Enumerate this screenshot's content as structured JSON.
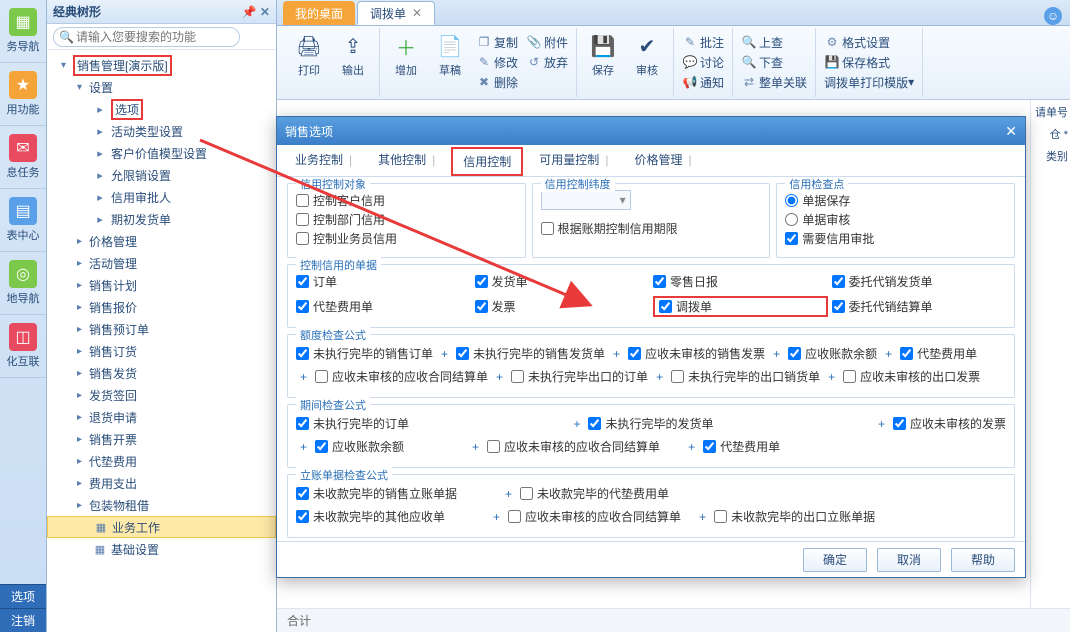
{
  "dock": {
    "items": [
      {
        "label": "务导航",
        "color": "#7cc84a"
      },
      {
        "label": "用功能",
        "color": "#f5a43a"
      },
      {
        "label": "息任务",
        "color": "#e84a5f"
      },
      {
        "label": "表中心",
        "color": "#5aa0e8"
      },
      {
        "label": "地导航",
        "color": "#7cc84a"
      },
      {
        "label": "化互联",
        "color": "#e84a5f"
      }
    ],
    "footer": [
      "选项",
      "注销"
    ]
  },
  "tree": {
    "title": "经典树形",
    "search_placeholder": "请输入您要搜索的功能",
    "root": "销售管理[演示版]",
    "settings": "设置",
    "leaves": [
      "选项",
      "活动类型设置",
      "客户价值模型设置",
      "允限销设置",
      "信用审批人",
      "期初发货单"
    ],
    "branches": [
      "价格管理",
      "活动管理",
      "销售计划",
      "销售报价",
      "销售预订单",
      "销售订货",
      "销售发货",
      "发货签回",
      "退货申请",
      "销售开票",
      "代垫费用",
      "费用支出",
      "包装物租借"
    ],
    "bottom": [
      "业务工作",
      "基础设置"
    ]
  },
  "tabs": {
    "t1": "我的桌面",
    "t2": "调拨单"
  },
  "ribbon": {
    "print": "打印",
    "output": "输出",
    "add": "增加",
    "draft": "草稿",
    "copy": "复制",
    "modify": "修改",
    "delete": "删除",
    "attach": "附件",
    "abandon": "放弃",
    "save": "保存",
    "audit": "审核",
    "approve": "批注",
    "discuss": "讨论",
    "notify": "通知",
    "up": "上查",
    "down": "下查",
    "rel": "整单关联",
    "format": "格式设置",
    "saveformat": "保存格式",
    "template": "调拨单打印模版"
  },
  "sidefields": [
    "请单号",
    "仓 *",
    "类别"
  ],
  "footer_label": "合计",
  "modal": {
    "title": "销售选项",
    "tabs": [
      "业务控制",
      "其他控制",
      "信用控制",
      "可用量控制",
      "价格管理"
    ],
    "g1": {
      "legend": "信用控制对象",
      "items": [
        "控制客户信用",
        "控制部门信用",
        "控制业务员信用"
      ]
    },
    "g2": {
      "legend": "信用控制纬度",
      "chk": "根据账期控制信用期限"
    },
    "g3": {
      "legend": "信用检查点",
      "r1": "单据保存",
      "r2": "单据审核",
      "c1": "需要信用审批"
    },
    "g4": {
      "legend": "控制信用的单据",
      "items": [
        "订单",
        "发货单",
        "零售日报",
        "委托代销发货单",
        "代垫费用单",
        "发票",
        "调拨单",
        "委托代销结算单"
      ]
    },
    "g5": {
      "legend": "额度检查公式",
      "items": [
        "未执行完毕的销售订单",
        "未执行完毕的销售发货单",
        "应收未审核的销售发票",
        "应收账款余额",
        "代垫费用单",
        "应收未审核的应收合同结算单",
        "未执行完毕出口的订单",
        "未执行完毕的出口销货单",
        "应收未审核的出口发票"
      ]
    },
    "g6": {
      "legend": "期间检查公式",
      "items": [
        "未执行完毕的订单",
        "未执行完毕的发货单",
        "应收未审核的发票",
        "应收账款余额",
        "应收未审核的应收合同结算单",
        "代垫费用单"
      ]
    },
    "g7": {
      "legend": "立账单据检查公式",
      "items": [
        "未收款完毕的销售立账单据",
        "未收款完毕的代垫费用单",
        "未收款完毕的其他应收单",
        "应收未审核的应收合同结算单",
        "未收款完毕的出口立账单据"
      ]
    },
    "buttons": {
      "ok": "确定",
      "cancel": "取消",
      "help": "帮助"
    }
  }
}
